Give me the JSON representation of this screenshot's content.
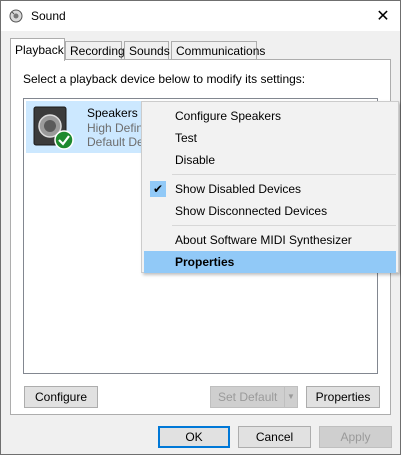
{
  "window": {
    "title": "Sound",
    "close_glyph": "✕"
  },
  "tabs": [
    {
      "label": "Playback",
      "active": true
    },
    {
      "label": "Recording"
    },
    {
      "label": "Sounds"
    },
    {
      "label": "Communications"
    }
  ],
  "panel": {
    "instruction": "Select a playback device below to modify its settings:"
  },
  "device": {
    "name": "Speakers",
    "line1": "High Defini",
    "line2": "Default De",
    "status_icon": "green-check-icon"
  },
  "context_menu": {
    "items": [
      {
        "label": "Configure Speakers"
      },
      {
        "label": "Test"
      },
      {
        "label": "Disable"
      },
      {
        "label": "Show Disabled Devices",
        "checked": true
      },
      {
        "label": "Show Disconnected Devices"
      },
      {
        "label": "About Software MIDI Synthesizer"
      },
      {
        "label": "Properties",
        "selected": true
      }
    ],
    "check_glyph": "✔"
  },
  "panel_buttons": {
    "configure": "Configure",
    "set_default": "Set Default",
    "dropdown_glyph": "▼",
    "properties": "Properties"
  },
  "dialog_buttons": {
    "ok": "OK",
    "cancel": "Cancel",
    "apply": "Apply"
  },
  "colors": {
    "selection": "#cce8ff",
    "menu_highlight": "#91c9f7",
    "focus_border": "#0078d7"
  }
}
